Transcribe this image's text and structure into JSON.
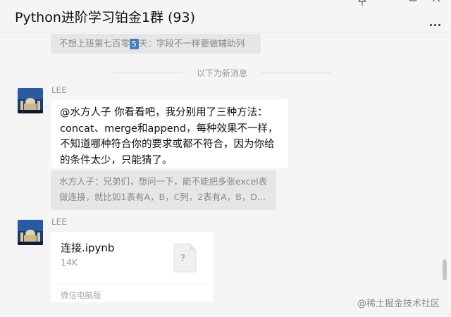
{
  "window": {
    "title": "Python进阶学习铂金1群 (93)",
    "controls": [
      "pin-icon",
      "minimize-icon",
      "maximize-icon",
      "close-icon"
    ],
    "more_icon": "more-icon"
  },
  "top_quote": {
    "prefix": "不想上班第七百零",
    "badge": "5",
    "suffix": "天：字段不一样要做辅助列"
  },
  "divider": {
    "text": "以下为新消息"
  },
  "messages": [
    {
      "sender": "LEE",
      "text_lines": [
        "@水方人子 你看看吧，我分别用了三种方法：",
        "concat、merge和append，每种效果不一样，",
        "不知道哪种符合你的要求或都不符合，因为你给",
        "的条件太少，只能猜了。"
      ],
      "quote_lines": [
        "水方人子：兄弟们，想问一下，能不能把多张excel表",
        "做连接，就比如1表有A，B，C列，2表有A，B，D..."
      ]
    },
    {
      "sender": "LEE",
      "file": {
        "name": "连接.ipynb",
        "size": "14K",
        "icon_label": "?",
        "source": "微信电脑版"
      }
    }
  ],
  "watermark": "@稀土掘金技术社区",
  "colors": {
    "background": "#f5f5f5",
    "bubble": "#ffffff",
    "quote": "#e6e6e6",
    "badge": "#4d7cb5"
  }
}
